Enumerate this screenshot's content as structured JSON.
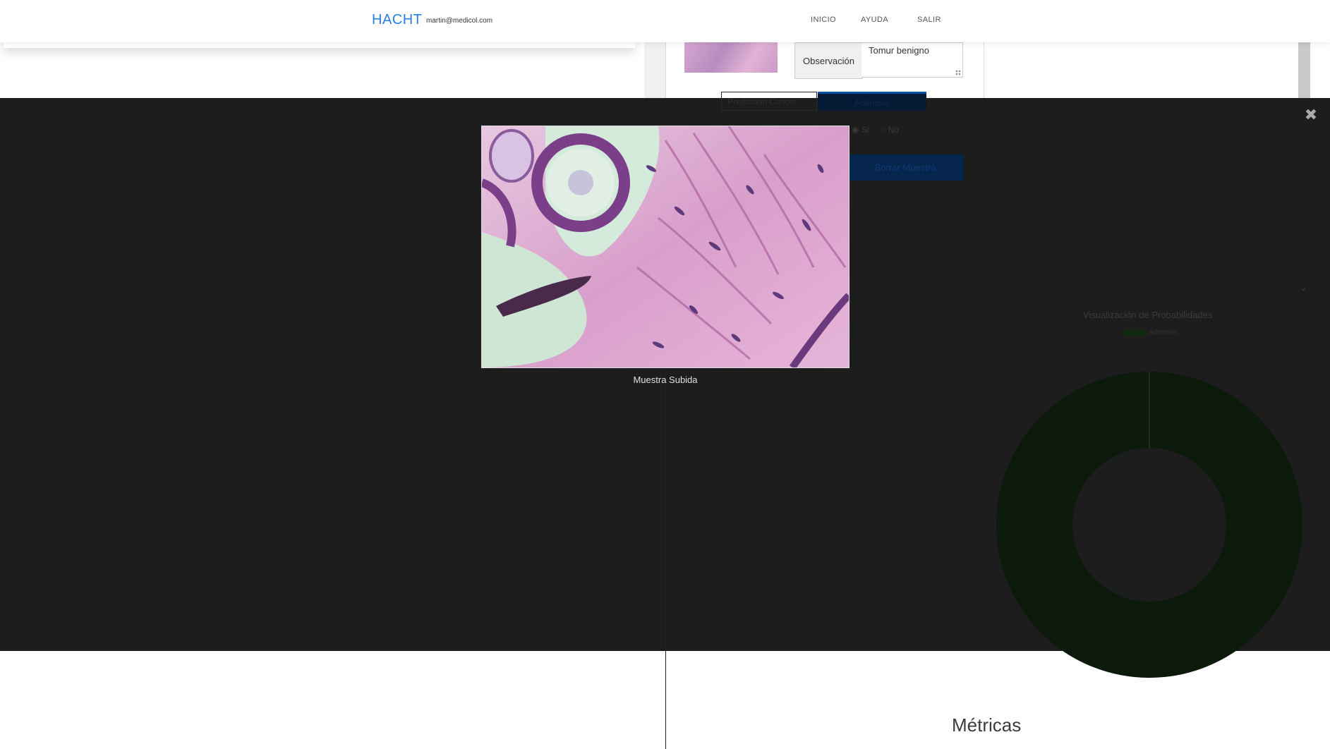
{
  "navbar": {
    "brand": "HACHT",
    "email": "martin@medicol.com",
    "links": {
      "inicio": "INICIO",
      "ayuda": "AYUDA",
      "salir": "SALIR"
    }
  },
  "sample_detail": {
    "observation_label": "Observación",
    "observation_value": "Tomur benigno"
  },
  "background": {
    "tab_prediccion": "Predicción Cancer",
    "tab_active": "Adenosis",
    "radio_si": "Si",
    "radio_no": "No",
    "delete_button": "Borrar Muestra",
    "chart_title": "Visualización de Probabilidades",
    "legend_label": "Adenosis",
    "metrics_title": "Métricas"
  },
  "modal": {
    "caption": "Muestra Subida",
    "close_icon": "close-icon"
  },
  "colors": {
    "brand": "#2a7de1",
    "overlay": "#1a1a1a",
    "active_tab": "#0a4fa8",
    "donut": "#0c1a0c"
  }
}
